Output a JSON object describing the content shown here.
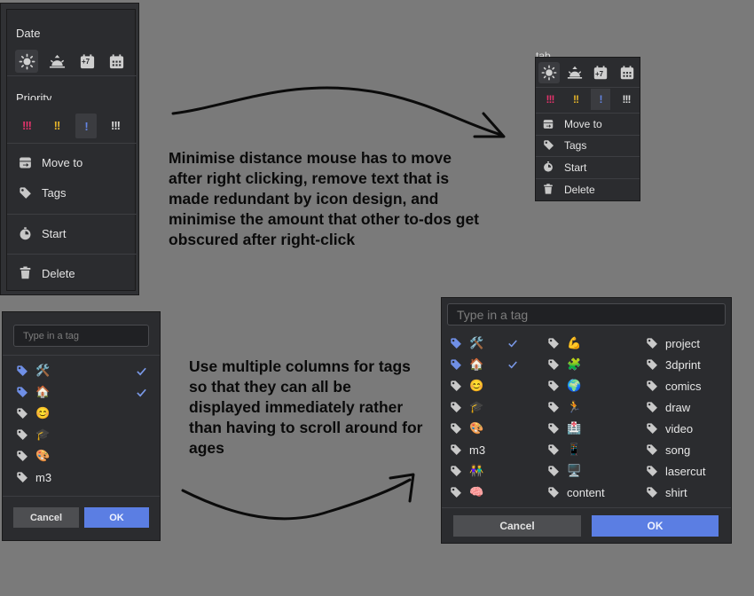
{
  "menu_large": {
    "date_label": "Date",
    "date_badge": "+7",
    "priority_label": "Priority",
    "priorities": [
      "!!!",
      "!!",
      "!",
      "!!!"
    ],
    "move_to": "Move to",
    "tags": "Tags",
    "start": "Start",
    "delete": "Delete"
  },
  "menu_small": {
    "partial_title": "tab",
    "date_badge": "+7",
    "priorities": [
      "!!!",
      "!!",
      "!",
      "!!!"
    ],
    "move_to": "Move to",
    "tags": "Tags",
    "start": "Start",
    "delete": "Delete"
  },
  "notes": {
    "top": "Minimise distance mouse has to move after right clicking, remove text that is made redundant by icon design, and minimise the amount that other to-dos get obscured after right-click",
    "bottom": "Use multiple columns for tags so that they can all be displayed immediately rather than having to scroll around for ages"
  },
  "tags_small": {
    "placeholder": "Type in a tag",
    "items": [
      "🛠️",
      "🏠",
      "😊",
      "🎓",
      "🎨",
      "m3"
    ],
    "cancel": "Cancel",
    "ok": "OK"
  },
  "tags_large": {
    "placeholder": "Type in a tag",
    "col1": [
      "🛠️",
      "🏠",
      "😊",
      "🎓",
      "🎨",
      "m3",
      "👫",
      "🧠"
    ],
    "col2": [
      "💪",
      "🧩",
      "🌍",
      "🏃",
      "🏥",
      "📱",
      "🖥️",
      "content"
    ],
    "col3": [
      "project",
      "3dprint",
      "comics",
      "draw",
      "video",
      "song",
      "lasercut",
      "shirt"
    ],
    "cancel": "Cancel",
    "ok": "OK"
  },
  "colors": {
    "panel": "#2b2c2f",
    "accent": "#5b7ee3",
    "tag_selected": "#6f8fe6",
    "tag_default": "#c9c9c9",
    "priority_high": "#e2336b",
    "priority_medium": "#e5b42a",
    "priority_low": "#6384e3",
    "priority_none": "#dcdcdc",
    "background": "#7a7a7a"
  },
  "icons": [
    "sun-icon",
    "sunset-icon",
    "calendar-plus7-icon",
    "calendar-icon",
    "move-to-icon",
    "tag-icon",
    "start-icon",
    "trash-icon",
    "check-icon"
  ]
}
